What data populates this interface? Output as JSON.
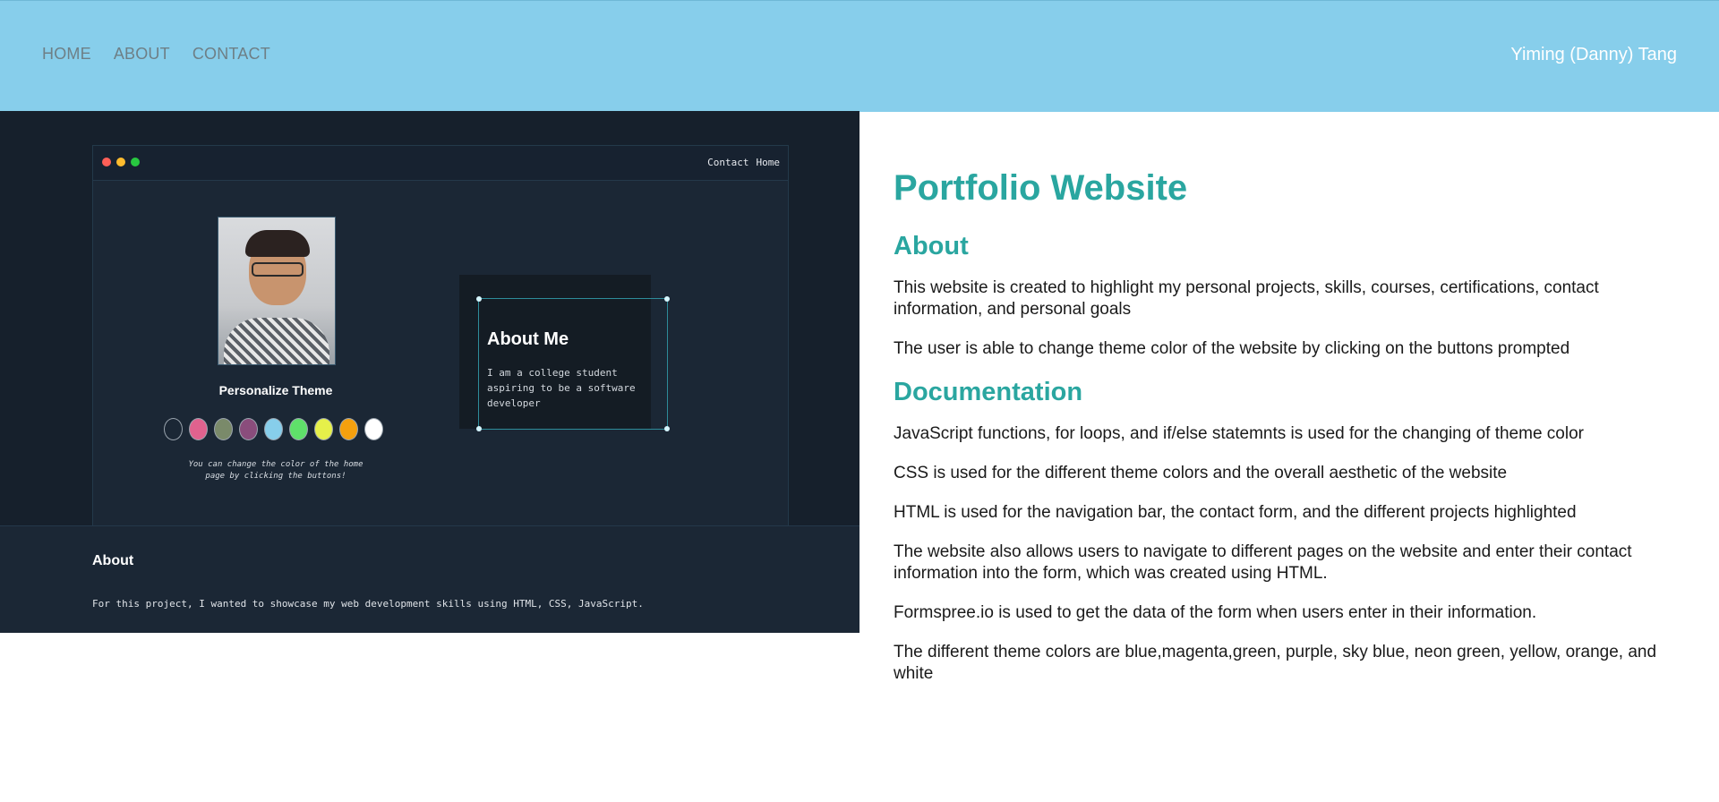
{
  "nav": {
    "items": [
      "HOME",
      "ABOUT",
      "CONTACT"
    ],
    "brand": "Yiming (Danny) Tang"
  },
  "screenshot": {
    "window_links": [
      "Contact",
      "Home"
    ],
    "personalize_title": "Personalize Theme",
    "swatch_colors": [
      "#1b2735",
      "#e0628e",
      "#7a8a6a",
      "#8a4d7c",
      "#87ceeb",
      "#5fe06a",
      "#e6f04a",
      "#f5a00e",
      "#ffffff"
    ],
    "personalize_note": "You can change the color of the home page by clicking the buttons!",
    "about_me_title": "About Me",
    "about_me_text": "I am a college student aspiring to be a software developer",
    "footer_title": "About",
    "footer_text": "For this project, I wanted to showcase my web development skills using HTML, CSS, JavaScript."
  },
  "content": {
    "title": "Portfolio Website",
    "about_heading": "About",
    "about_paragraphs": [
      "This website is created to highlight my personal projects, skills, courses, certifications, contact information, and personal goals",
      "The user is able to change theme color of the website by clicking on the buttons prompted"
    ],
    "doc_heading": "Documentation",
    "doc_paragraphs": [
      "JavaScript functions, for loops, and if/else statemnts is used for the changing of theme color",
      "CSS is used for the different theme colors and the overall aesthetic of the website",
      "HTML is used for the navigation bar, the contact form, and the different projects highlighted",
      "The website also allows users to navigate to different pages on the website and enter their contact information into the form, which was created using HTML.",
      "Formspree.io is used to get the data of the form when users enter in their information.",
      "The different theme colors are blue,magenta,green, purple, sky blue, neon green, yellow, orange, and white"
    ]
  },
  "colors": {
    "header": "#87ceeb",
    "accent": "#2aa6a0"
  }
}
